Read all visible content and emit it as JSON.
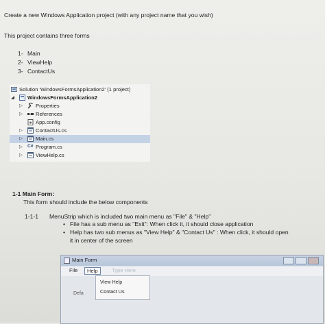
{
  "intro": {
    "line1": "Create a new Windows Application project (with any project name that you wish)",
    "line2": "This project contains three forms"
  },
  "forms_list": [
    {
      "num": "1-",
      "name": "Main"
    },
    {
      "num": "2-",
      "name": "ViewHelp"
    },
    {
      "num": "3-",
      "name": "ContactUs"
    }
  ],
  "solution_explorer": {
    "solution": "Solution 'WindowsFormsApplication2' (1 project)",
    "project": "WindowsFormsApplication2",
    "items": [
      {
        "label": "Properties",
        "icon": "wrench-icon"
      },
      {
        "label": "References",
        "icon": "references-icon"
      },
      {
        "label": "App.config",
        "icon": "config-file-icon"
      },
      {
        "label": "ContactUs.cs",
        "icon": "form-file-icon"
      },
      {
        "label": "Main.cs",
        "icon": "form-file-icon",
        "selected": true
      },
      {
        "label": "Program.cs",
        "icon": "csharp-file-icon"
      },
      {
        "label": "ViewHelp.cs",
        "icon": "form-file-icon"
      }
    ]
  },
  "section": {
    "heading": "1-1 Main Form:",
    "description": "This form should include the below components",
    "sub_num": "1-1-1",
    "sub_text": "MenuStrip which is included two main menu as \"File\" & \"Help\"",
    "bullets": [
      "File has a sub menu as \"Exit\": When click it, it should close application",
      "Help has two sub menus as \"View Help\" & \"Contact Us\" : When click, it should open",
      "it in center of the screen"
    ]
  },
  "main_form": {
    "title": "Main Form",
    "menu": [
      "File",
      "Help"
    ],
    "ghost_item": "Type Here",
    "dropdown": [
      "View Help",
      "Contact Us"
    ],
    "body_text": "Defa"
  },
  "colors": {
    "selection": "#c4d2e6",
    "title_bar": "#b7c6da"
  }
}
